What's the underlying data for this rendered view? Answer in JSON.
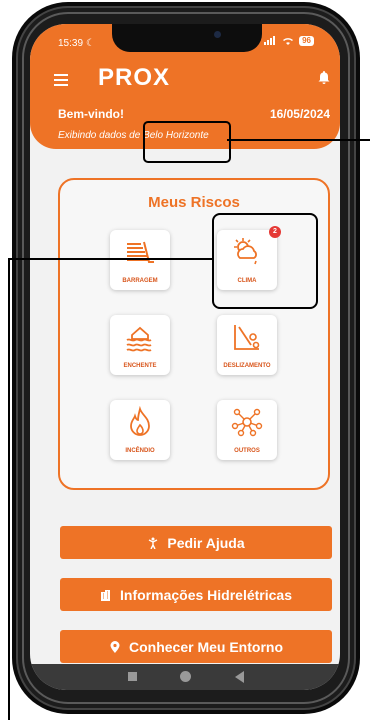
{
  "status_bar": {
    "time": "15:39",
    "moon_glyph": "☾",
    "battery": "96"
  },
  "app": {
    "logo": "PROX",
    "menu_icon": "hamburger-menu-icon",
    "bell_icon": "bell-icon"
  },
  "header": {
    "welcome": "Bem-vindo!",
    "date": "16/05/2024",
    "city_info": "Exibindo dados de Belo Horizonte"
  },
  "risks": {
    "title": "Meus Riscos",
    "items": [
      {
        "label": "BARRAGEM",
        "icon": "dam-icon"
      },
      {
        "label": "CLIMA",
        "icon": "weather-icon",
        "badge": "2"
      },
      {
        "label": "ENCHENTE",
        "icon": "flood-icon"
      },
      {
        "label": "DESLIZAMENTO",
        "icon": "landslide-icon"
      },
      {
        "label": "INCÊNDIO",
        "icon": "fire-icon"
      },
      {
        "label": "OUTROS",
        "icon": "network-icon"
      }
    ]
  },
  "actions": [
    {
      "label": "Pedir Ajuda",
      "icon": "person-help-icon"
    },
    {
      "label": "Informações Hidrelétricas",
      "icon": "building-icon"
    },
    {
      "label": "Conhecer Meu Entorno",
      "icon": "location-pin-icon"
    }
  ],
  "colors": {
    "accent": "#ee7326",
    "badge": "#e53935"
  }
}
